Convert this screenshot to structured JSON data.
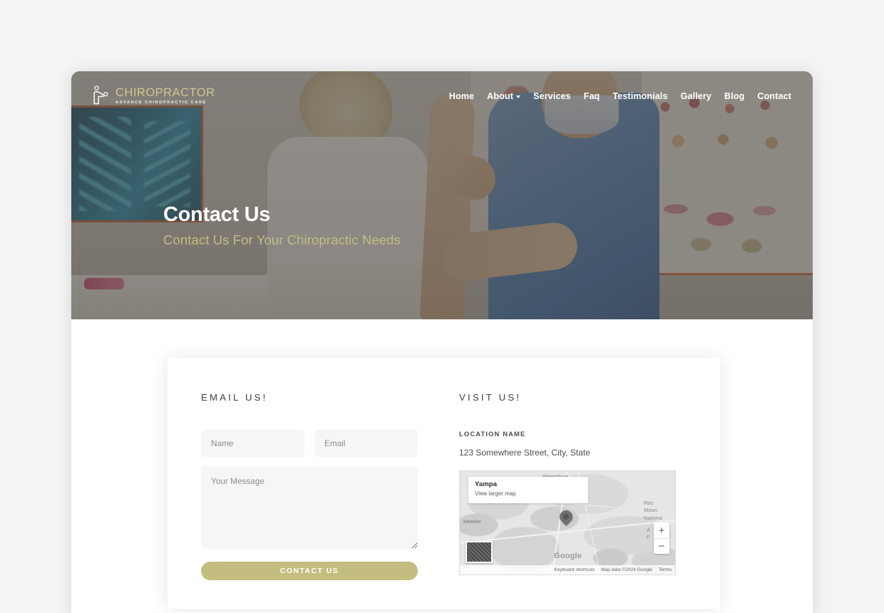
{
  "theme": {
    "accent": "#c3bd80",
    "page_bg": "#f4f4f4",
    "card_bg": "#ffffff",
    "overlay": "rgba(62,58,54,0.56)"
  },
  "header": {
    "brand_name": "CHIROPRACTOR",
    "brand_tagline": "ADVANCE CHIROPRACTIC CARE",
    "nav": [
      {
        "label": "Home",
        "has_dropdown": false
      },
      {
        "label": "About",
        "has_dropdown": true
      },
      {
        "label": "Services",
        "has_dropdown": false
      },
      {
        "label": "Faq",
        "has_dropdown": false
      },
      {
        "label": "Testimonials",
        "has_dropdown": false
      },
      {
        "label": "Gallery",
        "has_dropdown": false
      },
      {
        "label": "Blog",
        "has_dropdown": false
      },
      {
        "label": "Contact",
        "has_dropdown": false
      }
    ]
  },
  "hero": {
    "title": "Contact Us",
    "subtitle": "Contact Us For Your Chiropractic Needs"
  },
  "contact": {
    "form": {
      "heading": "EMAIL US!",
      "name_placeholder": "Name",
      "name_value": "",
      "email_placeholder": "Email",
      "email_value": "",
      "message_placeholder": "Your Message",
      "message_value": "",
      "submit_label": "CONTACT US"
    },
    "visit": {
      "heading": "VISIT US!",
      "location_name": "LOCATION NAME",
      "address": "123 Somewhere Street, City, State"
    }
  },
  "map": {
    "info_title": "Yampa",
    "info_link": "View larger map",
    "labels": {
      "steamboat": "Steamboat",
      "meeker": "Meeker",
      "park_line1": "Roc",
      "park_line2": "Moun",
      "park_line3": "Nationa",
      "side_line1": "A",
      "side_line2": "F"
    },
    "watermark": "Google",
    "zoom_in": "+",
    "zoom_out": "−",
    "footer": {
      "shortcuts": "Keyboard shortcuts",
      "attribution": "Map data ©2024 Google",
      "terms": "Terms"
    }
  }
}
